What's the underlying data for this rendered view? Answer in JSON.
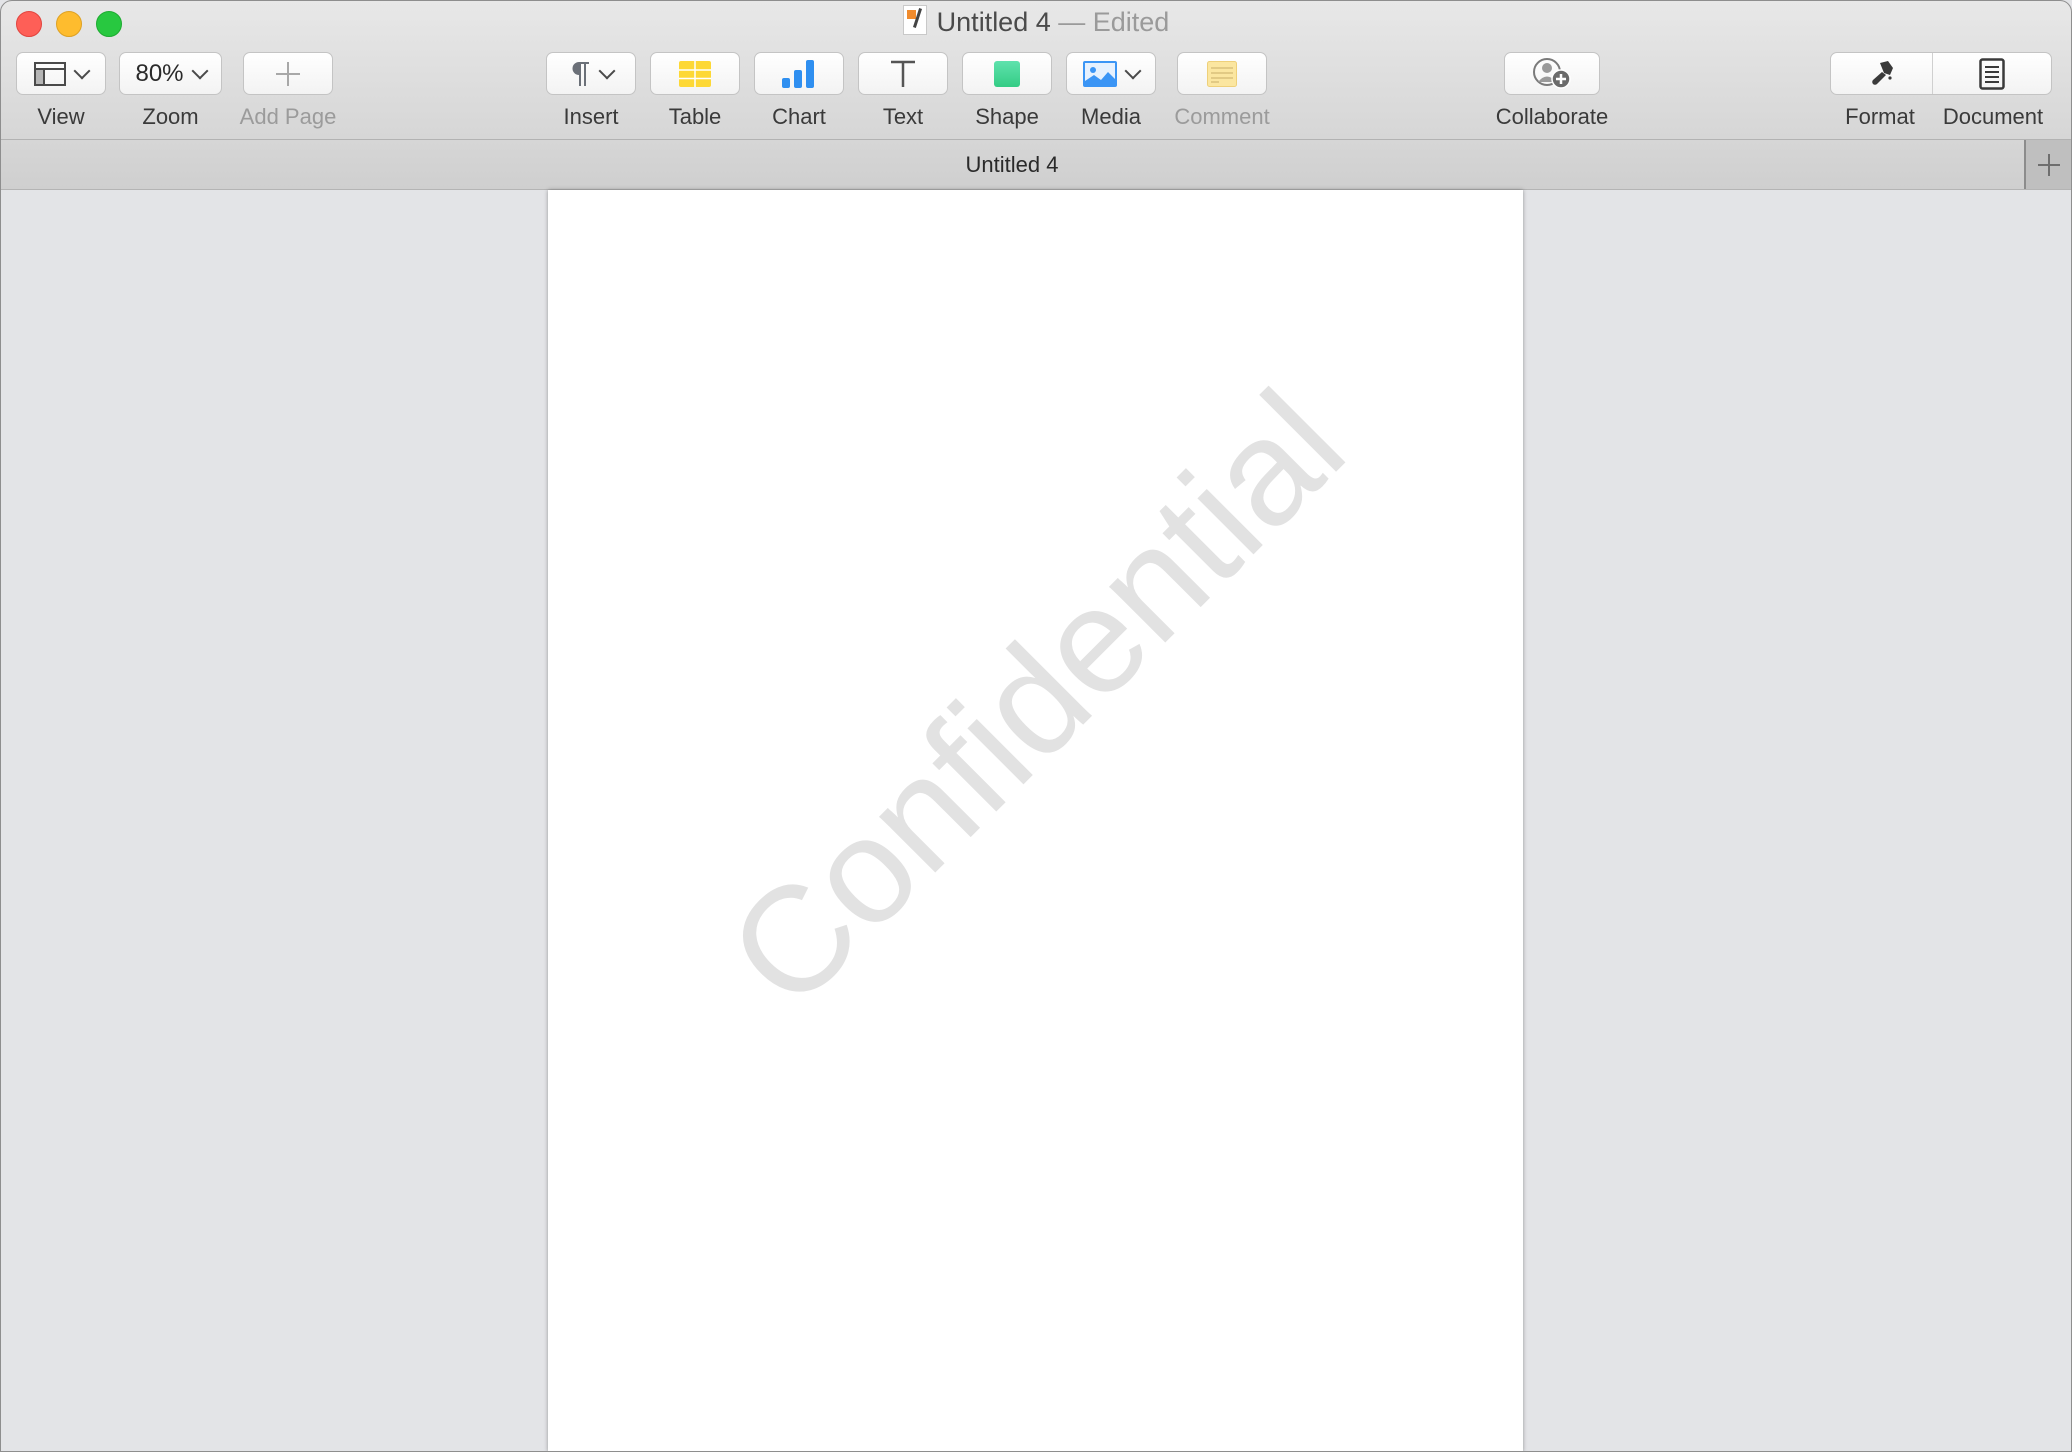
{
  "window": {
    "title": "Untitled 4",
    "title_suffix": " — Edited",
    "traffic_lights": [
      "close",
      "minimize",
      "zoom"
    ]
  },
  "toolbar": {
    "view": {
      "label": "View",
      "icon": "sidebar-layout-icon"
    },
    "zoom": {
      "label": "Zoom",
      "value": "80%"
    },
    "add_page": {
      "label": "Add Page",
      "icon": "plus-icon",
      "enabled": false
    },
    "insert": {
      "label": "Insert",
      "icon": "pilcrow-icon"
    },
    "table": {
      "label": "Table",
      "icon": "table-icon",
      "color": "#fdd835"
    },
    "chart": {
      "label": "Chart",
      "icon": "bar-chart-icon",
      "color": "#2f8ff0"
    },
    "text": {
      "label": "Text",
      "icon": "text-T-icon"
    },
    "shape": {
      "label": "Shape",
      "icon": "square-shape-icon",
      "color": "#3fd392"
    },
    "media": {
      "label": "Media",
      "icon": "photo-icon",
      "color": "#3b95f5"
    },
    "comment": {
      "label": "Comment",
      "icon": "sticky-note-icon",
      "enabled": false,
      "color": "#fbe6a0"
    },
    "collaborate": {
      "label": "Collaborate",
      "icon": "add-person-icon"
    },
    "format": {
      "label": "Format",
      "icon": "paintbrush-icon"
    },
    "document": {
      "label": "Document",
      "icon": "document-lines-icon"
    }
  },
  "tabbar": {
    "tab_title": "Untitled 4",
    "add_tab_icon": "plus-icon"
  },
  "document": {
    "watermark": "Confidential"
  }
}
